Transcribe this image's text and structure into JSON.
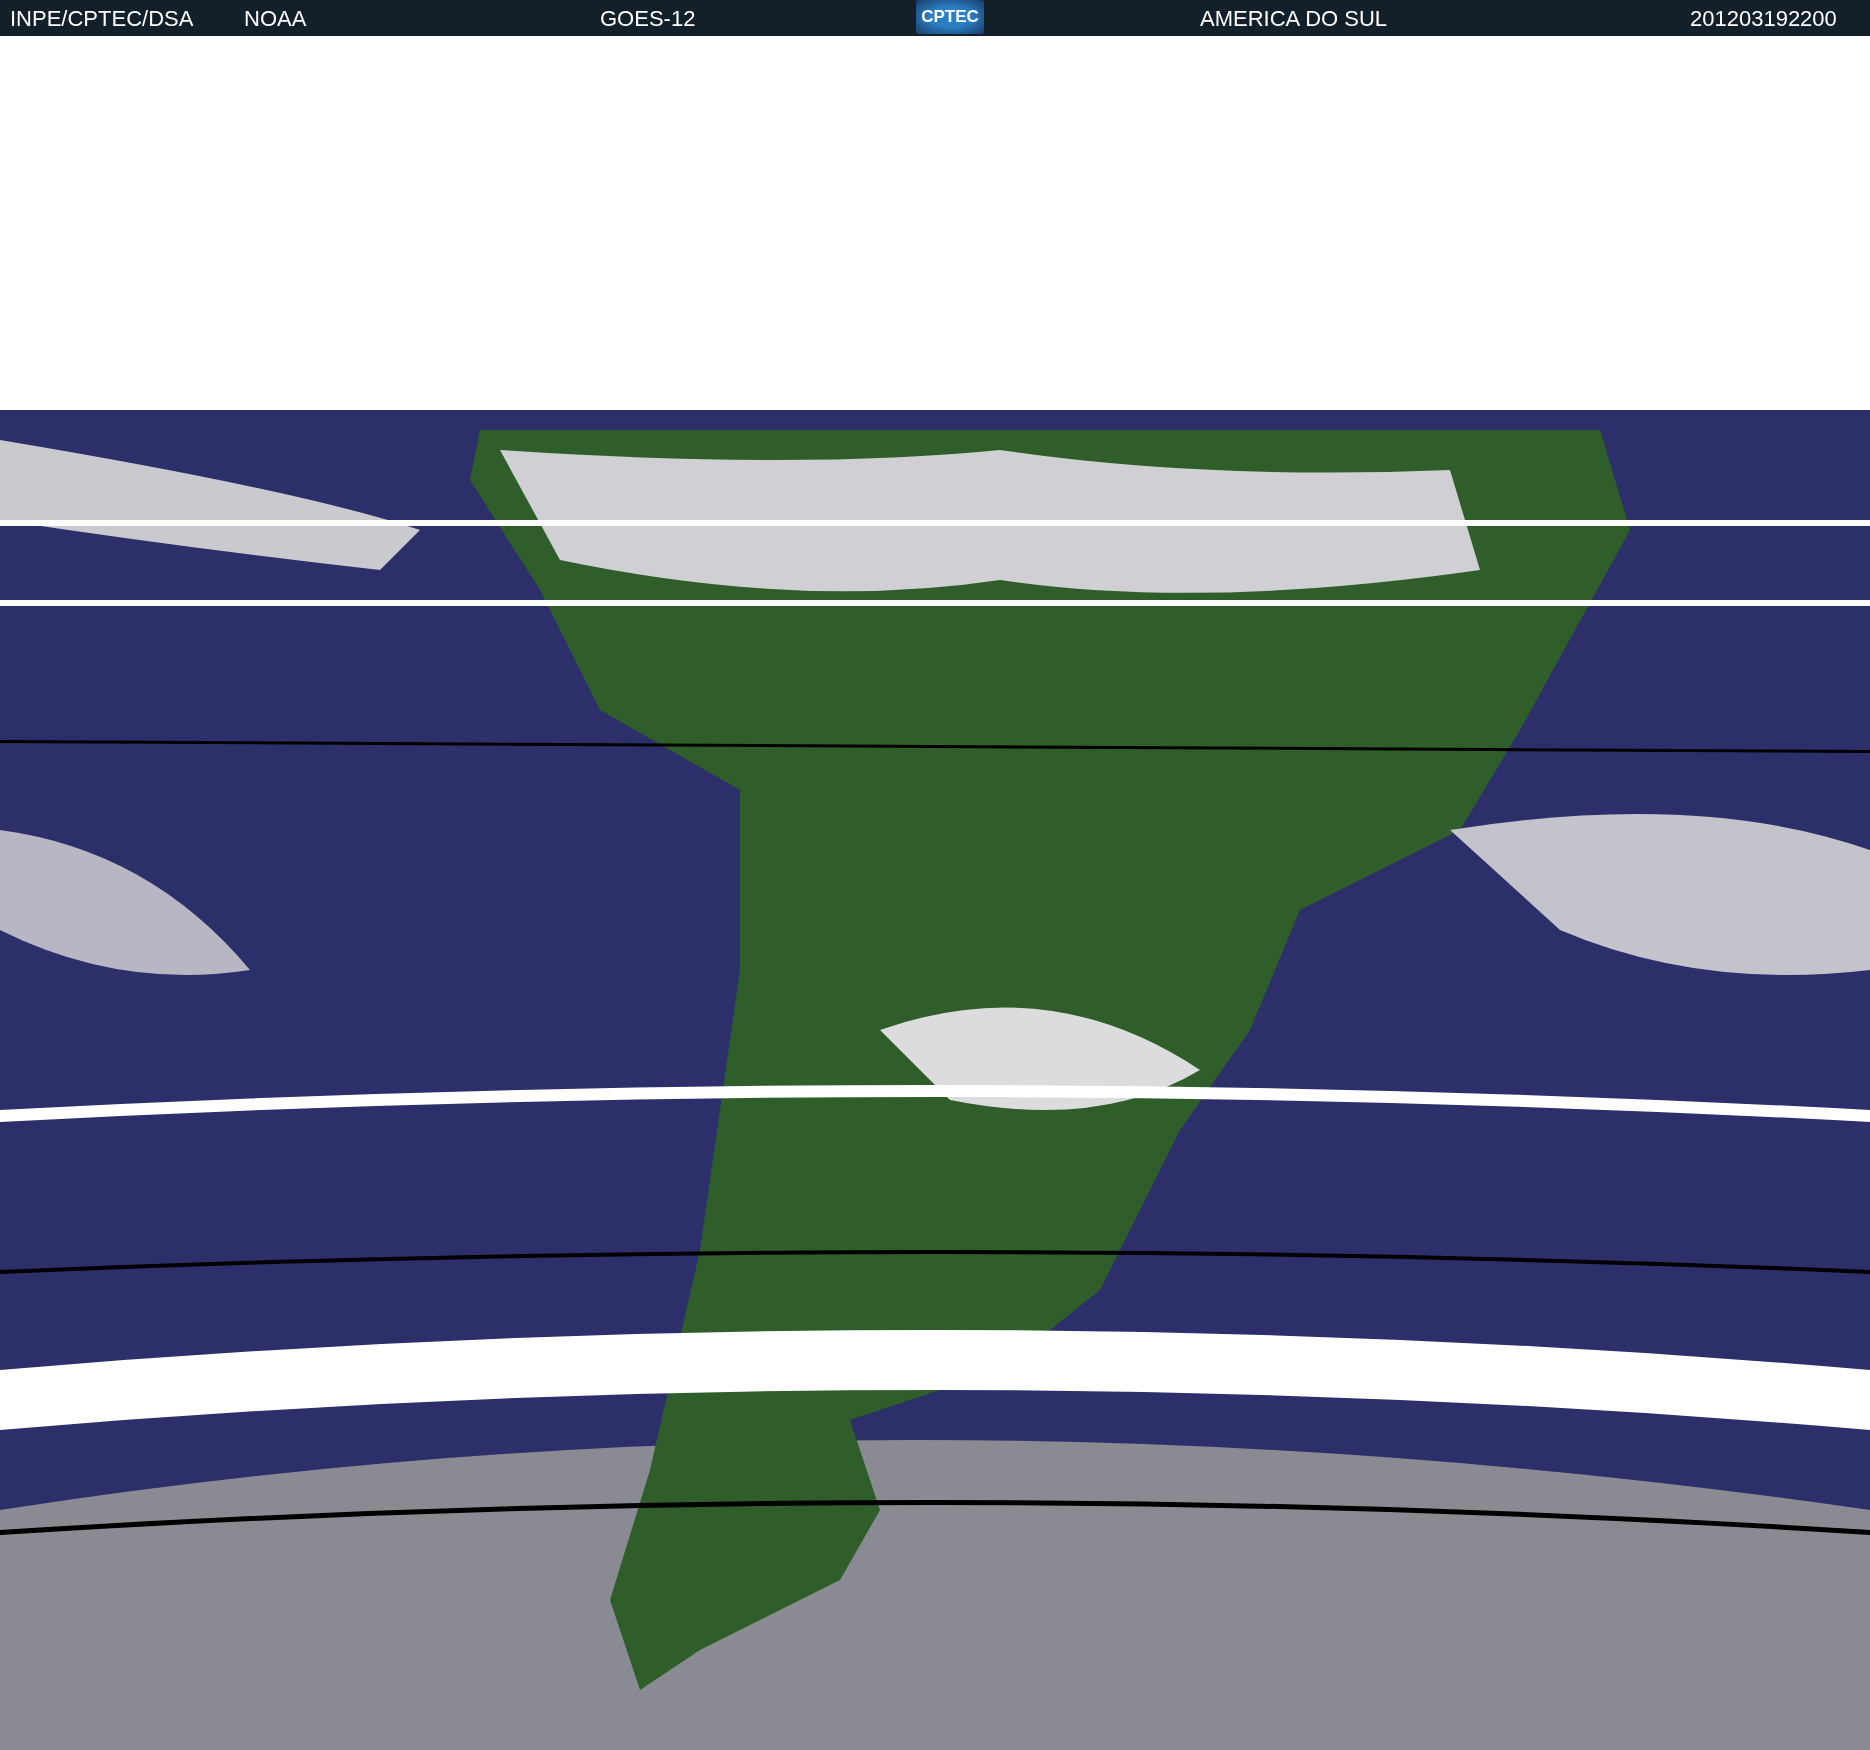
{
  "header": {
    "left": [
      "INPE/CPTEC/DSA",
      "NOAA"
    ],
    "satellite": "GOES-12",
    "logo": "CPTEC",
    "region": "AMERICA DO SUL",
    "timestamp": "201203192200"
  }
}
